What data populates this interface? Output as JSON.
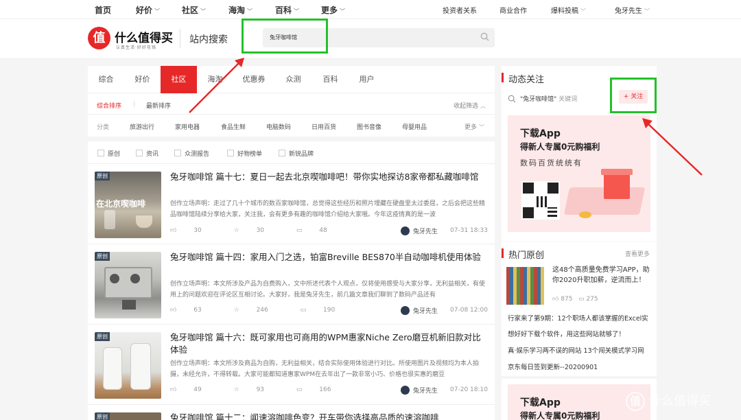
{
  "topnav": {
    "items": [
      "首页",
      "好价",
      "社区",
      "海淘",
      "百科",
      "更多"
    ],
    "right": [
      "投资者关系",
      "商业合作",
      "爆料投稿",
      "兔牙先生"
    ]
  },
  "header": {
    "logo_char": "值",
    "logo_text": "什么值得买",
    "logo_sub": "认真生活·好好花钱",
    "site_search": "站内搜索",
    "search_query": "兔牙咖啡馆"
  },
  "tabs": [
    "综合",
    "好价",
    "社区",
    "海淘",
    "优惠券",
    "众测",
    "百科",
    "用户"
  ],
  "sort": {
    "active": "综合排序",
    "latest": "最新排序",
    "collapse": "收起筛选"
  },
  "categories": {
    "label": "分类",
    "items": [
      "旅游出行",
      "家用电器",
      "食品生鲜",
      "电脑数码",
      "日用百货",
      "图书音像",
      "母婴用品"
    ],
    "more": "更多"
  },
  "filters": [
    "原创",
    "资讯",
    "众测报告",
    "好物榜单",
    "新锐品牌"
  ],
  "articles": [
    {
      "badge": "原创",
      "thumb_text": "在北京喫咖啡",
      "title": "兔牙咖啡馆 篇十七：夏日一起去北京喫咖啡吧！带你实地探访8家帝都私藏咖啡馆",
      "desc": "创作立场声明：走过了几十个城市的数百家咖啡馆，总觉得这些经历和照片埋藏在硬盘里太过委屈，之后会把这些精品咖啡馆陆续分享给大家，关注我，会有更多有趣的咖啡馆介绍给大家哦。今年这疫情真的是一波",
      "likes": "30",
      "stars": "30",
      "comments": "48",
      "author": "兔牙先生",
      "date": "07-31 18:33"
    },
    {
      "badge": "原创",
      "title": "兔牙咖啡馆 篇十四：家用入门之选，铂富Breville BES870半自动咖啡机使用体验",
      "desc": "创作立场声明：本文所涉及产品为自费购入，文中所述代表个人观点，仅将使用感受与大家分享，无利益相关，有使用上的问题欢迎在评论区互相讨论。大家好，我是兔牙先生，前几篇文章我们聊到了数码产品还有",
      "likes": "63",
      "stars": "246",
      "comments": "190",
      "author": "兔牙先生",
      "date": "07-08 12:00"
    },
    {
      "badge": "原创",
      "title": "兔牙咖啡馆 篇十六：既可家用也可商用的WPM惠家Niche Zero磨豆机新旧款对比体验",
      "desc": "创作立场声明：本文所涉及商品为自购，无利益相关，结合实际使用体验进行对比。所使用图片及视频均为本人拍摄，未经允许，不得转载。大家可能都知道惠家WPM在去年出了一款非常小巧、价格也很实惠的磨豆",
      "likes": "49",
      "stars": "93",
      "comments": "166",
      "author": "兔牙先生",
      "date": "07-20 18:10"
    },
    {
      "badge": "原创",
      "title": "兔牙咖啡馆 篇十二：闻速溶咖啡色变？开车带你选择高品质的速溶咖啡"
    }
  ],
  "follow": {
    "title": "动态关注",
    "keyword": "\"兔牙咖啡馆\"",
    "keyword_suffix": "关键词",
    "button": "+ 关注"
  },
  "app_promo": {
    "line1": "下载App",
    "line2": "得新人专属0元购福利",
    "line3": "数码百货统统有"
  },
  "hot": {
    "title": "热门原创",
    "more": "查看更多",
    "feature_title": "这48个高质量免费学习APP，助你2020升职加薪，逆流而上！",
    "feature_likes": "875",
    "feature_comments": "275",
    "list": [
      "行家来了第9期：12个职场人都该掌握的Excel实",
      "想好好下载个软件，用这些网站就够了！",
      "真·娱乐学习两不误的网站 13个闯关模式学习网",
      "京东每日签到更新--20200901"
    ]
  },
  "watermark": "什么值得买",
  "colors": {
    "brand_red": "#e62828",
    "highlight_green": "#22c12a"
  }
}
